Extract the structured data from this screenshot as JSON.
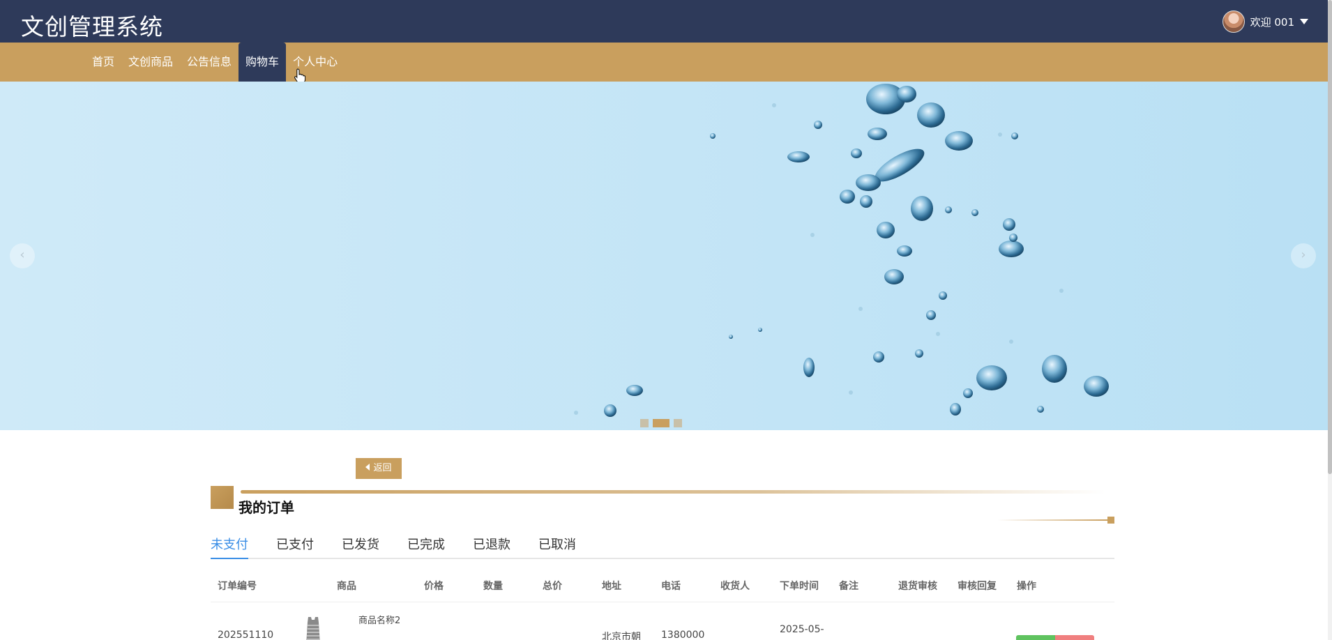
{
  "header": {
    "app_title": "文创管理系统",
    "welcome": "欢迎 001"
  },
  "nav": {
    "items": [
      {
        "label": "首页",
        "active": false
      },
      {
        "label": "文创商品",
        "active": false
      },
      {
        "label": "公告信息",
        "active": false
      },
      {
        "label": "购物车",
        "active": true
      },
      {
        "label": "个人中心",
        "active": false
      }
    ]
  },
  "banner": {
    "prev_arrow": "‹",
    "next_arrow": "›",
    "slide_count": 3,
    "active_slide": 2
  },
  "orders": {
    "back_label": "返回",
    "title": "我的订单",
    "tabs": [
      {
        "label": "未支付",
        "active": true
      },
      {
        "label": "已支付",
        "active": false
      },
      {
        "label": "已发货",
        "active": false
      },
      {
        "label": "已完成",
        "active": false
      },
      {
        "label": "已退款",
        "active": false
      },
      {
        "label": "已取消",
        "active": false
      }
    ],
    "columns": [
      "订单编号",
      "商品",
      "价格",
      "数量",
      "总价",
      "地址",
      "电话",
      "收货人",
      "下单时间",
      "备注",
      "退货审核",
      "审核回复",
      "操作"
    ],
    "rows": [
      {
        "order_no": "202551110",
        "product_name": "商品名称2",
        "address": "北京市朝",
        "phone": "1380000",
        "order_time": "2025-05-"
      }
    ]
  },
  "colors": {
    "header_bg": "#2e3a5a",
    "nav_bg": "#c99f5e",
    "accent_blue": "#3a8ee6"
  }
}
